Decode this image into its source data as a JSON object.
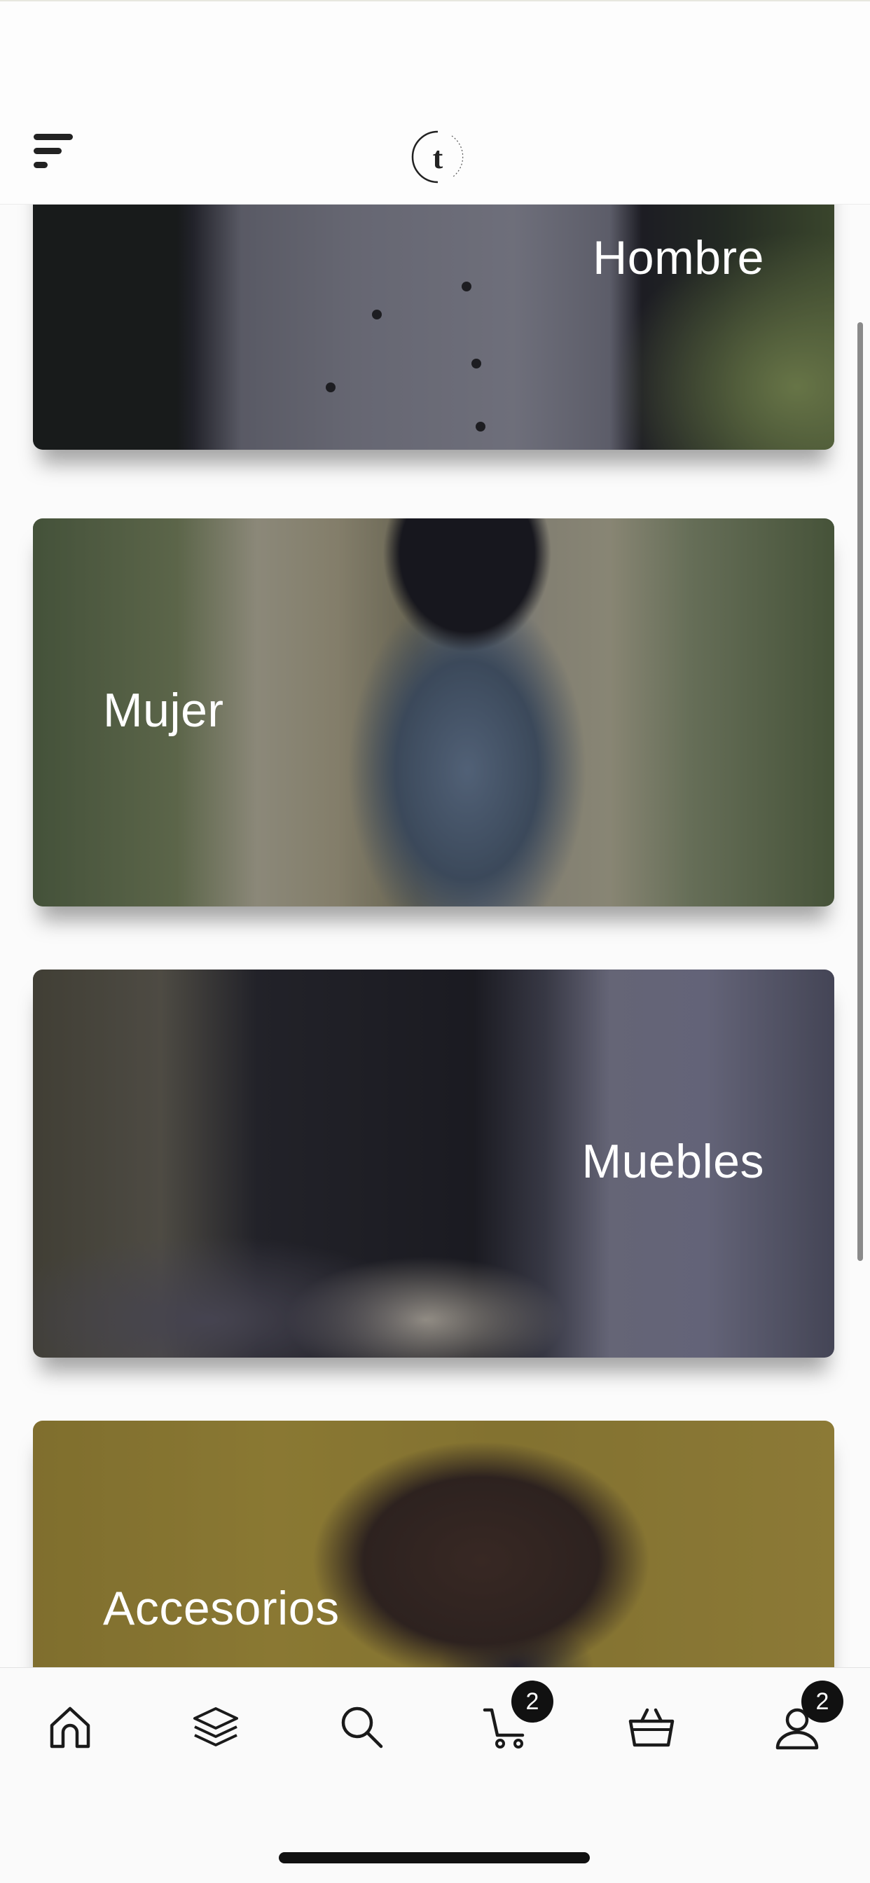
{
  "header": {
    "menu_icon": "menu-icon",
    "logo_icon": "brand-logo"
  },
  "categories": [
    {
      "label": "Hombre"
    },
    {
      "label": "Mujer"
    },
    {
      "label": "Muebles"
    },
    {
      "label": "Accesorios"
    }
  ],
  "tabbar": {
    "tabs": [
      {
        "icon": "home-icon"
      },
      {
        "icon": "layers-icon"
      },
      {
        "icon": "search-icon"
      },
      {
        "icon": "cart-icon",
        "badge": "2"
      },
      {
        "icon": "basket-icon"
      },
      {
        "icon": "user-icon",
        "badge": "2"
      }
    ]
  }
}
